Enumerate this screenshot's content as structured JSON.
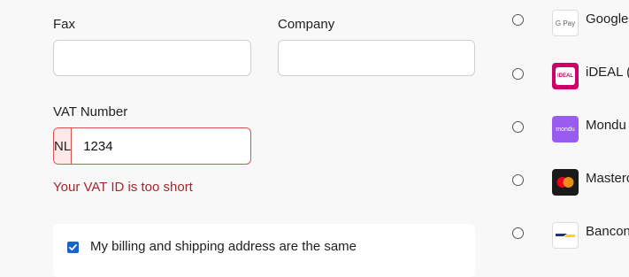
{
  "form": {
    "fax_label": "Fax",
    "fax_value": "",
    "company_label": "Company",
    "company_value": "",
    "vat_label": "VAT Number",
    "vat_prefix": "NL",
    "vat_value": "1234",
    "vat_error": "Your VAT ID is too short",
    "same_address_label": "My billing and shipping address are the same",
    "same_address_checked": true
  },
  "payment_methods": [
    {
      "name": "Google",
      "logo_text": "G Pay",
      "icon": "google-pay-icon",
      "selected": false
    },
    {
      "name": "iDEAL (",
      "logo_text": "iDEAL",
      "icon": "ideal-icon",
      "selected": false
    },
    {
      "name": "Mondu",
      "logo_text": "mondu",
      "icon": "mondu-icon",
      "selected": false
    },
    {
      "name": "Masterc",
      "logo_text": "",
      "icon": "mastercard-icon",
      "selected": false
    },
    {
      "name": "Bancon",
      "logo_text": "",
      "icon": "bancontact-icon",
      "selected": false
    }
  ],
  "colors": {
    "error": "#a5262c",
    "checkbox": "#1665c8",
    "ideal": "#cc0066",
    "mondu": "#9a5cf0",
    "mastercard_red": "#eb001b",
    "mastercard_orange": "#f79e1b"
  }
}
